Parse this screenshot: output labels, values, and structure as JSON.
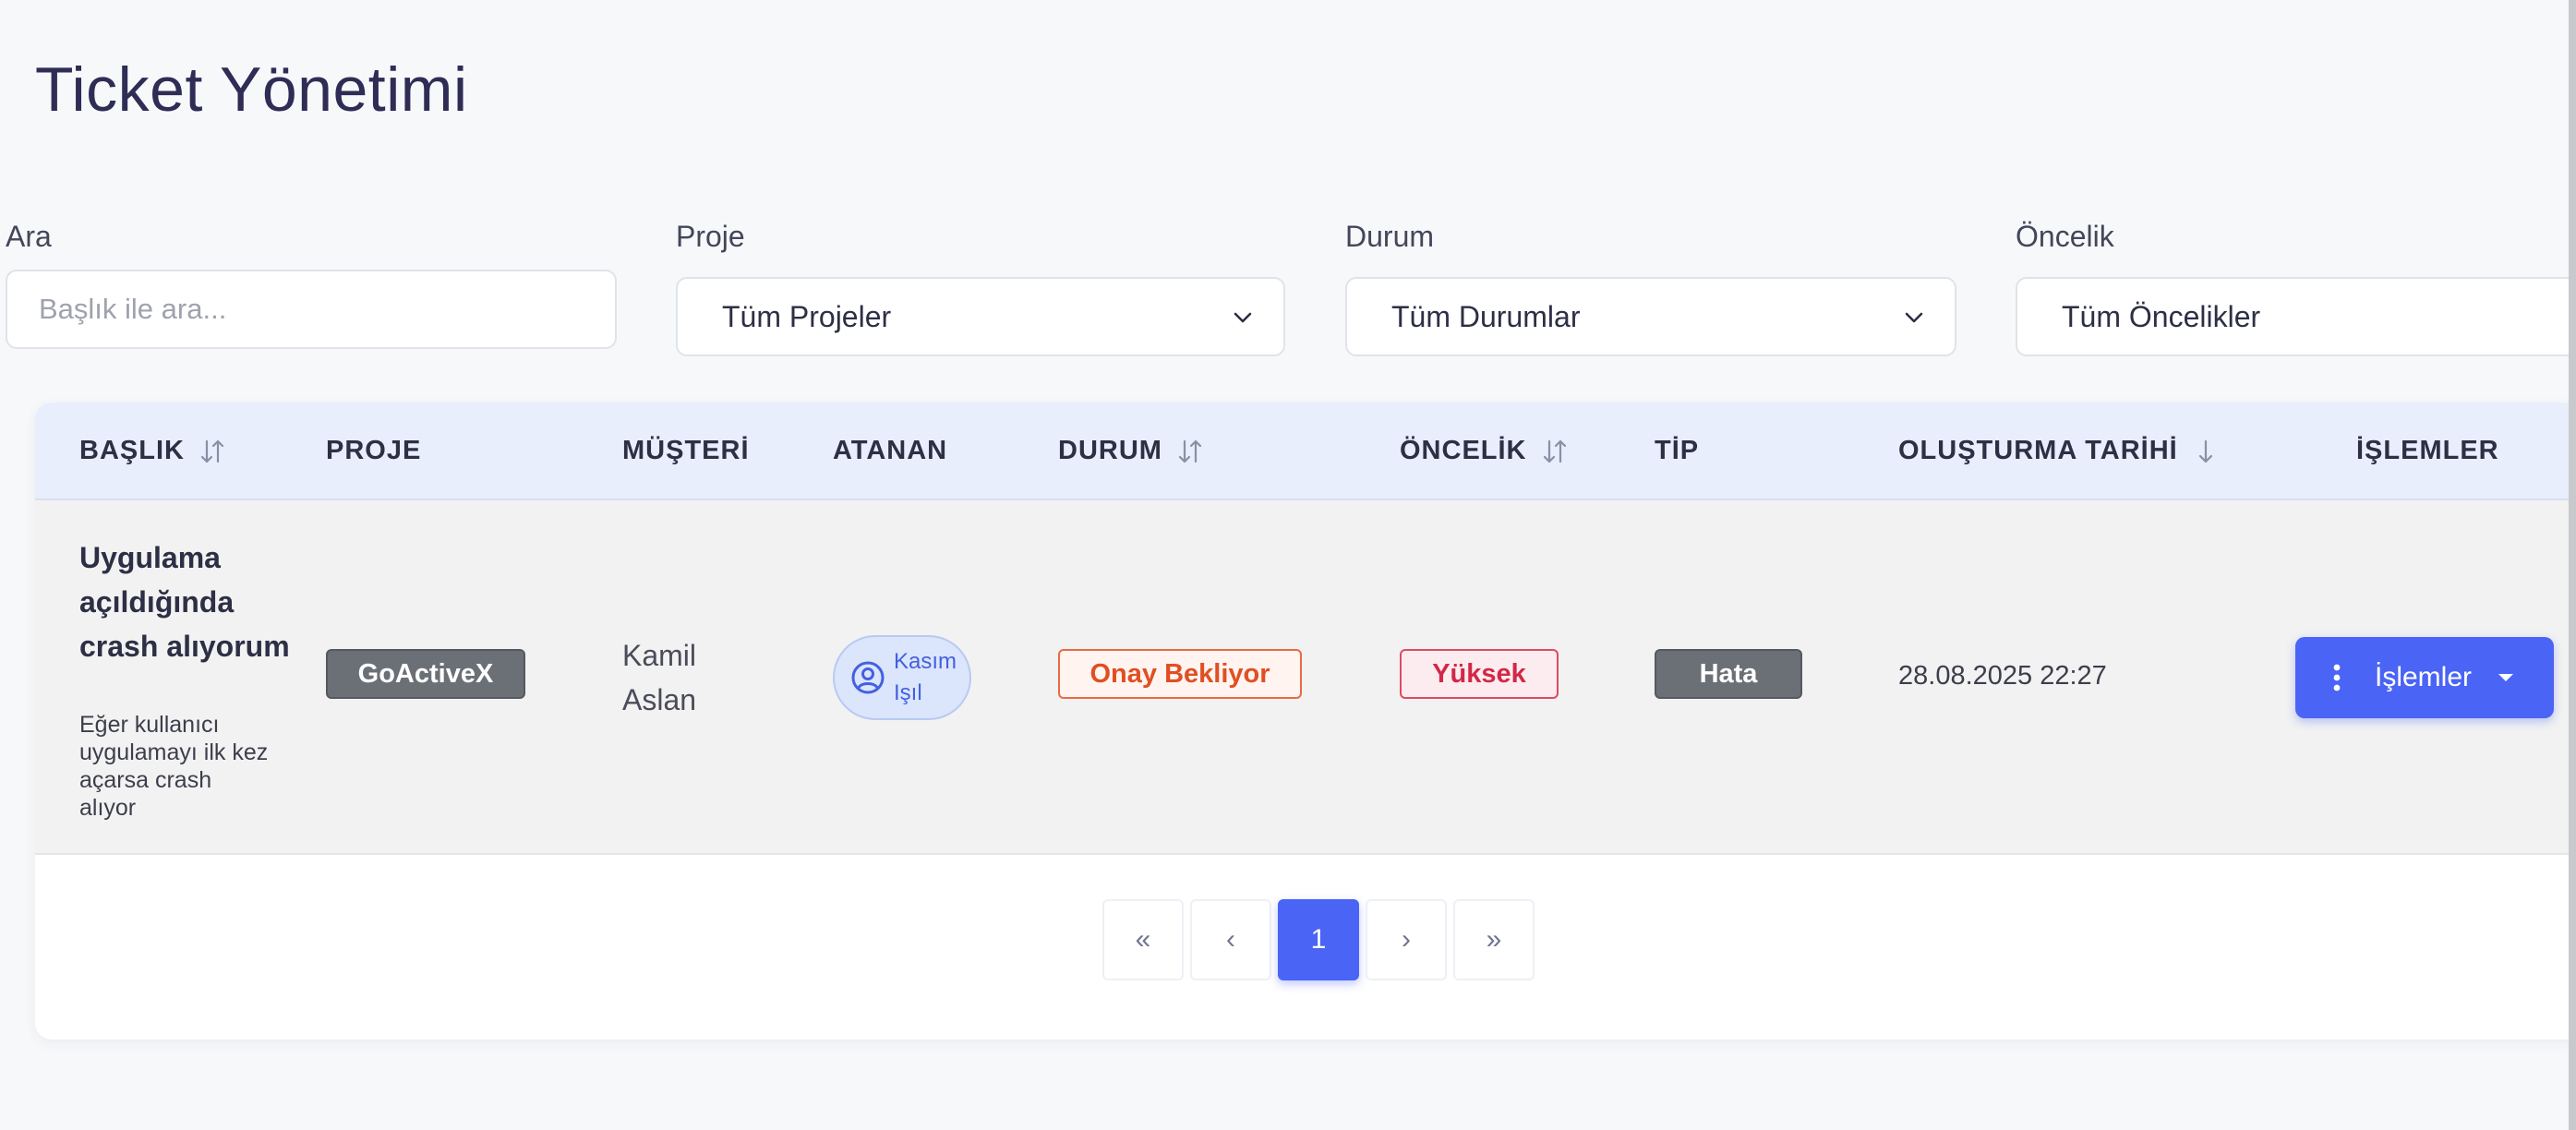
{
  "page": {
    "title": "Ticket Yönetimi"
  },
  "filters": {
    "search": {
      "label": "Ara",
      "placeholder": "Başlık ile ara..."
    },
    "project": {
      "label": "Proje",
      "value": "Tüm Projeler"
    },
    "status": {
      "label": "Durum",
      "value": "Tüm Durumlar"
    },
    "priority": {
      "label": "Öncelik",
      "value": "Tüm Öncelikler"
    }
  },
  "table": {
    "columns": [
      {
        "label": "BAŞLIK",
        "sort": "both"
      },
      {
        "label": "PROJE",
        "sort": "none"
      },
      {
        "label": "MÜŞTERİ",
        "sort": "none"
      },
      {
        "label": "ATANAN",
        "sort": "none"
      },
      {
        "label": "DURUM",
        "sort": "both"
      },
      {
        "label": "ÖNCELİK",
        "sort": "both"
      },
      {
        "label": "TİP",
        "sort": "none"
      },
      {
        "label": "OLUŞTURMA TARİHİ",
        "sort": "desc"
      },
      {
        "label": "İŞLEMLER",
        "sort": "none"
      }
    ],
    "rows": [
      {
        "title": "Uygulama açıldığında crash alıyorum",
        "description": "Eğer kullanıcı uygulamayı ilk kez açarsa crash alıyor",
        "project": "GoActiveX",
        "customer": "Kamil Aslan",
        "assignee": "Kasım Işıl",
        "status": "Onay Bekliyor",
        "priority": "Yüksek",
        "type": "Hata",
        "created": "28.08.2025 22:27",
        "actions_label": "İşlemler"
      }
    ]
  },
  "pagination": {
    "first": "«",
    "prev": "‹",
    "current": "1",
    "next": "›",
    "last": "»"
  },
  "colors": {
    "accent": "#4a64f5",
    "status_pending": "#e04f22",
    "priority_high": "#d22846",
    "badge_gray": "#6b7077"
  },
  "icons": {
    "select": "chevron-down-icon",
    "sort": "sort-icon",
    "sort_desc": "arrow-down-icon",
    "assignee": "user-circle-icon",
    "actions": "vertical-dots-icon",
    "actions_caret": "caret-down-icon"
  }
}
